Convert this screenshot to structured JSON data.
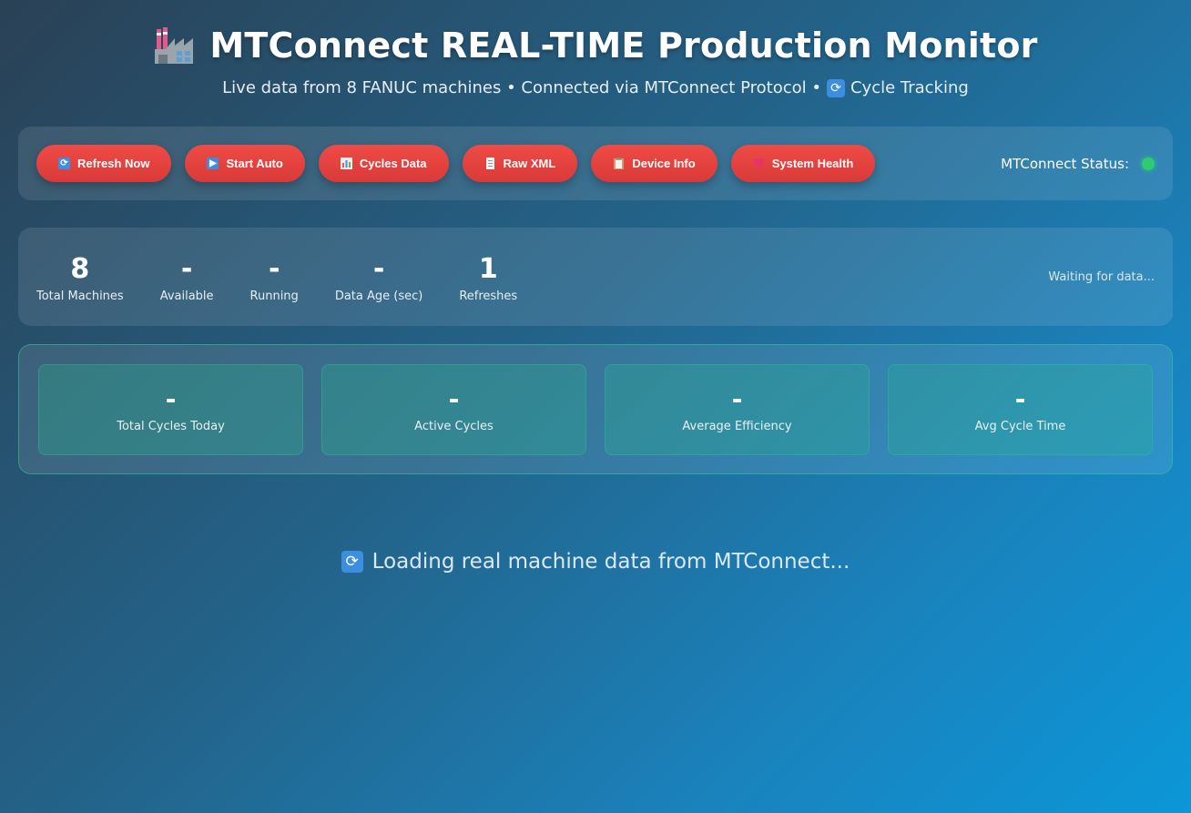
{
  "header": {
    "title": "MTConnect REAL-TIME Production Monitor",
    "subtitle_main": "Live data from 8 FANUC machines • Connected via MTConnect Protocol •",
    "subtitle_tail": "Cycle Tracking"
  },
  "toolbar": {
    "buttons": [
      {
        "label": "Refresh Now",
        "icon": "refresh-icon"
      },
      {
        "label": "Start Auto",
        "icon": "play-icon"
      },
      {
        "label": "Cycles Data",
        "icon": "bar-chart-icon"
      },
      {
        "label": "Raw XML",
        "icon": "document-icon"
      },
      {
        "label": "Device Info",
        "icon": "clipboard-icon"
      },
      {
        "label": "System Health",
        "icon": "heart-icon"
      }
    ],
    "status_label": "MTConnect Status:",
    "status_color": "#2ecc71"
  },
  "stats": {
    "items": [
      {
        "value": "8",
        "label": "Total Machines"
      },
      {
        "value": "-",
        "label": "Available"
      },
      {
        "value": "-",
        "label": "Running"
      },
      {
        "value": "-",
        "label": "Data Age (sec)"
      },
      {
        "value": "1",
        "label": "Refreshes"
      }
    ],
    "waiting_text": "Waiting for data..."
  },
  "cycles": {
    "cards": [
      {
        "value": "-",
        "label": "Total Cycles Today"
      },
      {
        "value": "-",
        "label": "Active Cycles"
      },
      {
        "value": "-",
        "label": "Average Efficiency"
      },
      {
        "value": "-",
        "label": "Avg Cycle Time"
      }
    ]
  },
  "loading": {
    "text": "Loading real machine data from MTConnect..."
  },
  "colors": {
    "button_red": "#e4413f",
    "accent_green": "#2ecc96"
  }
}
